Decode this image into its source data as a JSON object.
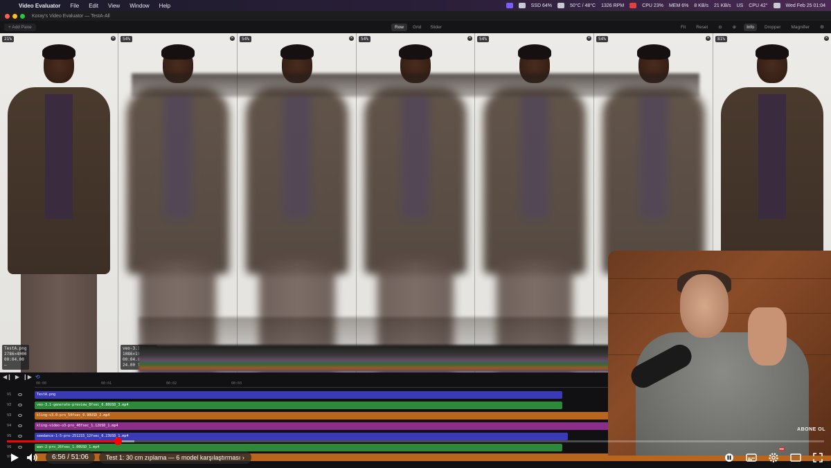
{
  "menubar": {
    "app_name": "Video Evaluator",
    "menus": [
      "File",
      "Edit",
      "View",
      "Window",
      "Help"
    ],
    "status_items": [
      "SSD 64%",
      "50°C / 48°C",
      "1326 RPM",
      "CPU 23%",
      "MEM 6%",
      "8 KB/s",
      "21 KB/s",
      "US",
      "CPU 42°"
    ],
    "datetime": "Wed Feb 25  01:04"
  },
  "window": {
    "title": "Koray's Video Evaluator — TestA-All"
  },
  "toolbar": {
    "add_pane": "+ Add Pane",
    "modes": [
      "Row",
      "Grid",
      "Slider"
    ],
    "active_mode": "Row",
    "fit": "Fit",
    "reset": "Reset",
    "info": "Info",
    "dropper": "Dropper",
    "magnifier": "Magnifier"
  },
  "panes": [
    {
      "zoom": "21%",
      "info": [
        "TestA.png",
        "2786×4000",
        "00:04.00",
        "—"
      ]
    },
    {
      "zoom": "54%",
      "info": [
        "veo-3.1-gene…",
        "1086×1920",
        "00:04.00",
        "24.00 fps"
      ]
    },
    {
      "zoom": "54%",
      "info": []
    },
    {
      "zoom": "54%",
      "info": []
    },
    {
      "zoom": "54%",
      "info": []
    },
    {
      "zoom": "54%",
      "info": []
    },
    {
      "zoom": "81%",
      "info": []
    }
  ],
  "timeline": {
    "ruler": [
      "00:00",
      "00:01",
      "00:02",
      "00:03"
    ],
    "tracks": [
      {
        "label": "V1",
        "clip": "TestA.png",
        "color": "#3a3ab8"
      },
      {
        "label": "V2",
        "clip": "veo-3.1-generate-preview_8fsec_0.80USD_3.mp4",
        "color": "#2e8a3a"
      },
      {
        "label": "V3",
        "clip": "kling-v3.0-pro_54fsec_0.90USD_2.mp4",
        "color": "#b8661e"
      },
      {
        "label": "V4",
        "clip": "kling-video-o3-pro_40fsec_1.12USD_1.mp4",
        "color": "#8a2e8a"
      },
      {
        "label": "V5",
        "clip": "seedance-1-5-pro-251215_12fsec_0.23USD_1.mp4",
        "color": "#3a3ab8"
      },
      {
        "label": "V6",
        "clip": "wan-2-pro_26fsec_1.00USD_1.mp4",
        "color": "#2e8a3a"
      },
      {
        "label": "V7",
        "clip": "",
        "color": "#b8661e"
      }
    ]
  },
  "webcam": {
    "brand": "ABONE OL"
  },
  "player": {
    "time": "6:56 / 51:06",
    "chapter": "Test 1: 30 cm zıplama — 6 model karşılaştırması",
    "progress_fraction": 0.136,
    "buffered_fraction": 0.02,
    "hd_badge": "HD"
  }
}
